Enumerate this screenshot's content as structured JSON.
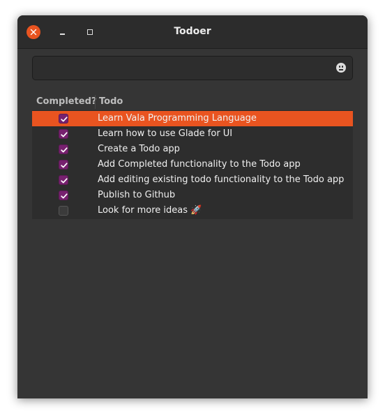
{
  "window": {
    "title": "Todoer",
    "accent_color": "#e95420",
    "checkbox_color": "#77216f"
  },
  "entry": {
    "value": "",
    "placeholder": "",
    "icon": "emoji-icon"
  },
  "tree": {
    "columns": [
      "Completed?",
      "Todo"
    ],
    "rows": [
      {
        "completed": true,
        "todo": "Learn Vala Programming Language",
        "selected": true
      },
      {
        "completed": true,
        "todo": "Learn how to use Glade for UI",
        "selected": false
      },
      {
        "completed": true,
        "todo": "Create a Todo app",
        "selected": false
      },
      {
        "completed": true,
        "todo": "Add Completed functionality to the Todo app",
        "selected": false
      },
      {
        "completed": true,
        "todo": "Add editing existing todo functionality to the Todo app",
        "selected": false
      },
      {
        "completed": true,
        "todo": "Publish to Github",
        "selected": false
      },
      {
        "completed": false,
        "todo": "Look for more ideas 🚀",
        "selected": false
      }
    ]
  }
}
